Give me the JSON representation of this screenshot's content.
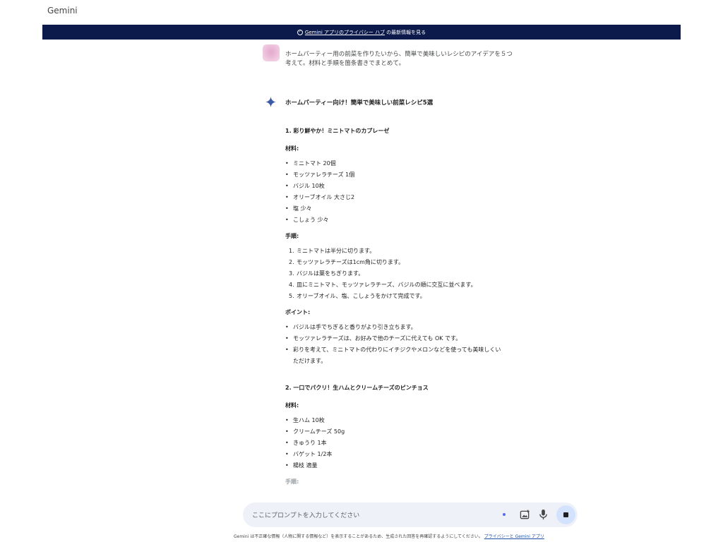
{
  "app": {
    "title": "Gemini"
  },
  "banner": {
    "link_text": "Gemini アプリのプライバシー ハブ",
    "rest_text": "の最新情報を見る",
    "icon": "info-icon"
  },
  "user": {
    "line1": "ホームパーティー用の前菜を作りたいから、簡単で美味しいレシピのアイデアを５つ",
    "line2": "考えて。材料と手順を箇条書きでまとめて。"
  },
  "response": {
    "title": "ホームパーティー向け！簡単で美味しい前菜レシピ5選",
    "recipes": [
      {
        "title": "1. 彩り鮮やか！ミニトマトのカプレーゼ",
        "ingredients_label": "材料:",
        "ingredients": [
          "ミニトマト 20個",
          "モッツァレラチーズ 1個",
          "バジル 10枚",
          "オリーブオイル 大さじ2",
          "塩 少々",
          "こしょう 少々"
        ],
        "steps_label": "手順:",
        "steps": [
          {
            "num": "1.",
            "text": "ミニトマトは半分に切ります。"
          },
          {
            "num": "2.",
            "text": "モッツァレラチーズは1cm角に切ります。"
          },
          {
            "num": "3.",
            "text": "バジルは葉をちぎります。"
          },
          {
            "num": "4.",
            "text": "皿にミニトマト、モッツァレラチーズ、バジルの順に交互に並べます。"
          },
          {
            "num": "5.",
            "text": "オリーブオイル、塩、こしょうをかけて完成です。"
          }
        ],
        "points_label": "ポイント:",
        "points": [
          {
            "line1": "バジルは手でちぎると香りがより引き立ちます。"
          },
          {
            "line1": "モッツァレラチーズは、お好みで他のチーズに代えても OK です。"
          },
          {
            "line1": "彩りを考えて、ミニトマトの代わりにイチジクやメロンなどを使っても美味しくい",
            "line2": "ただけます。"
          }
        ]
      },
      {
        "title": "2. 一口でパクリ！生ハムとクリームチーズのピンチョス",
        "ingredients_label": "材料:",
        "ingredients": [
          "生ハム 10枚",
          "クリームチーズ 50g",
          "きゅうり 1本",
          "バゲット 1/2本",
          "楊枝 適量"
        ],
        "steps_label": "手順:"
      }
    ]
  },
  "input": {
    "placeholder": "ここにプロンプトを入力してください",
    "icons": [
      "spark-dot-icon",
      "image-upload-icon",
      "microphone-icon",
      "stop-icon"
    ]
  },
  "footer": {
    "disclaimer": "Gemini は不正確な情報（人物に関する情報など）を表示することがあるため、生成された回答を再確認するようにしてください。",
    "link": "プライバシーと Gemini アプリ"
  }
}
